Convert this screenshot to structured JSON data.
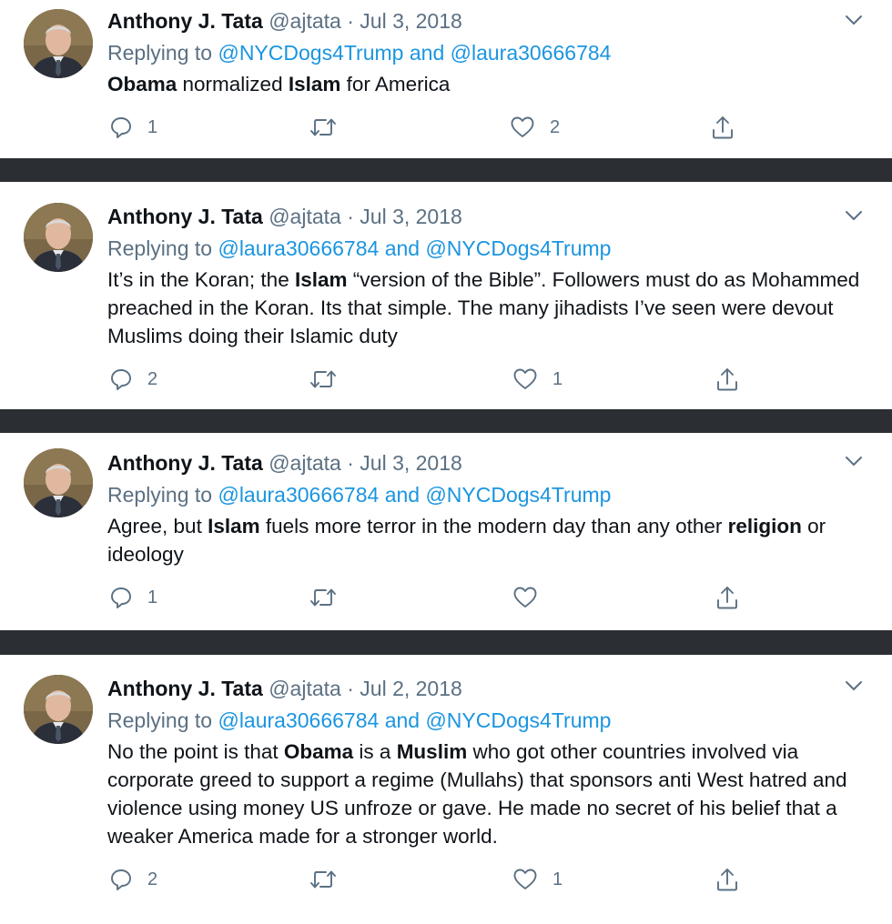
{
  "tweets": [
    {
      "author_name": "Anthony J. Tata",
      "handle": "@ajtata",
      "separator": "·",
      "date": "Jul 3, 2018",
      "replying_prefix": "Replying to",
      "mention_1": "@NYCDogs4Trump",
      "replying_and": "and",
      "mention_2": "@laura30666784",
      "body": [
        {
          "b": true,
          "t": "Obama"
        },
        {
          "b": false,
          "t": " normalized "
        },
        {
          "b": true,
          "t": "Islam"
        },
        {
          "b": false,
          "t": " for America"
        }
      ],
      "reply_count": "1",
      "retweet_count": "",
      "like_count": "2"
    },
    {
      "author_name": "Anthony J. Tata",
      "handle": "@ajtata",
      "separator": "·",
      "date": "Jul 3, 2018",
      "replying_prefix": "Replying to",
      "mention_1": "@laura30666784",
      "replying_and": "and",
      "mention_2": "@NYCDogs4Trump",
      "body": [
        {
          "b": false,
          "t": "It’s in the Koran; the "
        },
        {
          "b": true,
          "t": "Islam"
        },
        {
          "b": false,
          "t": " “version of the Bible”. Followers must do as Mohammed preached in the Koran. Its that simple. The many jihadists I’ve seen were devout Muslims doing their Islamic duty"
        }
      ],
      "reply_count": "2",
      "retweet_count": "",
      "like_count": "1"
    },
    {
      "author_name": "Anthony J. Tata",
      "handle": "@ajtata",
      "separator": "·",
      "date": "Jul 3, 2018",
      "replying_prefix": "Replying to",
      "mention_1": "@laura30666784",
      "replying_and": "and",
      "mention_2": "@NYCDogs4Trump",
      "body": [
        {
          "b": false,
          "t": "Agree, but "
        },
        {
          "b": true,
          "t": "Islam"
        },
        {
          "b": false,
          "t": " fuels more terror in the modern day than any other "
        },
        {
          "b": true,
          "t": "religion"
        },
        {
          "b": false,
          "t": " or ideology"
        }
      ],
      "reply_count": "1",
      "retweet_count": "",
      "like_count": ""
    },
    {
      "author_name": "Anthony J. Tata",
      "handle": "@ajtata",
      "separator": "·",
      "date": "Jul 2, 2018",
      "replying_prefix": "Replying to",
      "mention_1": "@laura30666784",
      "replying_and": "and",
      "mention_2": "@NYCDogs4Trump",
      "body": [
        {
          "b": false,
          "t": "No the point is that "
        },
        {
          "b": true,
          "t": "Obama"
        },
        {
          "b": false,
          "t": " is a "
        },
        {
          "b": true,
          "t": "Muslim"
        },
        {
          "b": false,
          "t": " who got other countries involved via corporate greed to support a regime (Mullahs) that sponsors anti West hatred and violence using money US unfroze or gave. He made no secret of his belief that a weaker America made for a stronger world."
        }
      ],
      "reply_count": "2",
      "retweet_count": "",
      "like_count": "1"
    }
  ],
  "icons": {
    "reply": "reply-icon",
    "retweet": "retweet-icon",
    "like": "heart-icon",
    "share": "share-icon",
    "more": "chevron-down-icon"
  },
  "colors": {
    "name": "#0f1419",
    "secondary": "#5b7083",
    "mention": "#1b95e0",
    "divider": "#2b2f33"
  }
}
